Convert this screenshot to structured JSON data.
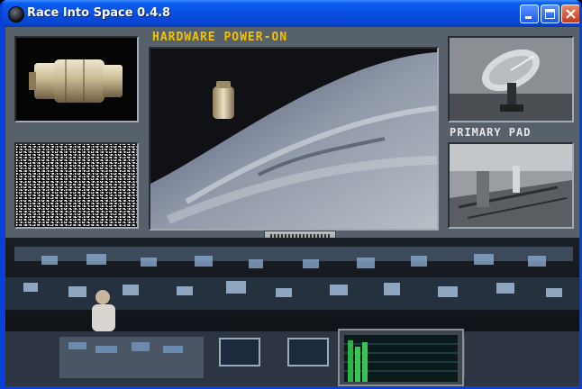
{
  "window": {
    "title": "Race Into Space 0.4.8",
    "icons": [
      "app-icon",
      "minimize-icon",
      "maximize-icon",
      "close-icon"
    ]
  },
  "game": {
    "main_screen_label": "HARDWARE POWER-ON",
    "right_screen_label": "PRIMARY PAD",
    "label_colors": {
      "main": "#f2c200",
      "right": "#e6e6e6"
    },
    "scenes": {
      "top_left": "capsule-module",
      "middle_left": "tv-static",
      "main": "capsule-over-earth",
      "top_right": "radar-dish",
      "bottom_right": "launch-pad"
    },
    "console": {
      "control_knobs": 4,
      "level_meter_bars": [
        0.92,
        0.78,
        0.88
      ]
    }
  }
}
